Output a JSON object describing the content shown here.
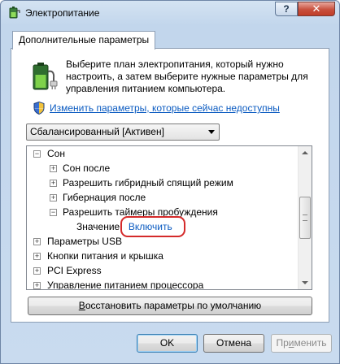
{
  "window": {
    "title": "Электропитание",
    "help_label": "?",
    "close_label": "✕"
  },
  "tab": {
    "label": "Дополнительные параметры"
  },
  "description": "Выберите план электропитания, который нужно настроить, а затем выберите нужные параметры для управления питанием компьютера.",
  "change_link": "Изменить параметры, которые сейчас недоступны",
  "plan_select": {
    "value": "Сбалансированный [Активен]"
  },
  "tree": {
    "sleep": {
      "label": "Сон",
      "expander": "−"
    },
    "sleep_after": {
      "label": "Сон после",
      "expander": "+"
    },
    "hybrid": {
      "label": "Разрешить гибридный спящий режим",
      "expander": "+"
    },
    "hibernate": {
      "label": "Гибернация после",
      "expander": "+"
    },
    "wake_timers": {
      "label": "Разрешить таймеры пробуждения",
      "expander": "−"
    },
    "value_row": {
      "label": "Значение:",
      "value": "Включить"
    },
    "usb": {
      "label": "Параметры USB",
      "expander": "+"
    },
    "power_buttons": {
      "label": "Кнопки питания и крышка",
      "expander": "+"
    },
    "pci": {
      "label": "PCI Express",
      "expander": "+"
    },
    "cpu": {
      "label": "Управление питанием процессора",
      "expander": "+"
    }
  },
  "buttons": {
    "restore": {
      "underlined": "В",
      "rest": "осстановить параметры по умолчанию"
    },
    "ok": "OK",
    "cancel": "Отмена",
    "apply": {
      "rest_before": "Пр",
      "underlined": "и",
      "rest_after": "менить"
    }
  },
  "colors": {
    "link": "#0b5bc1",
    "highlight_ring": "#d42a2a"
  },
  "icons": {
    "title": "power-options-icon",
    "battery": "battery-plug-icon",
    "shield": "uac-shield-icon"
  }
}
